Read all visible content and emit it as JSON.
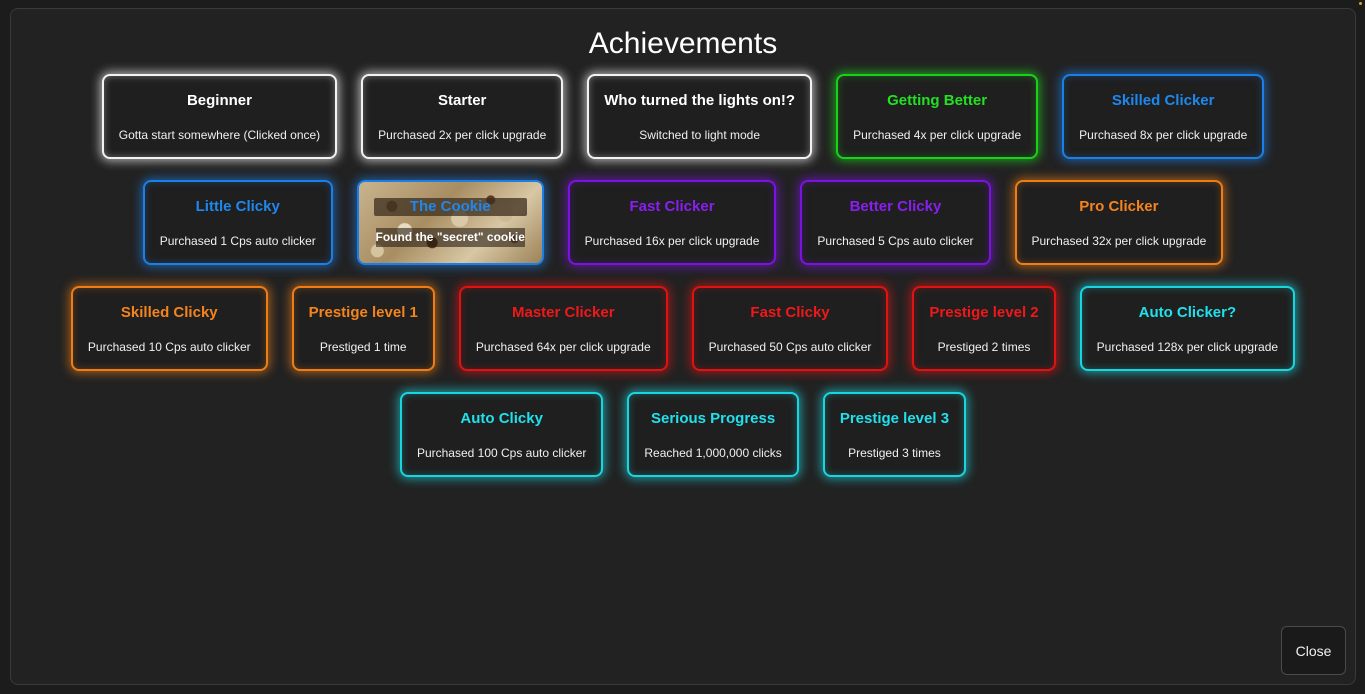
{
  "title": "Achievements",
  "close_label": "Close",
  "colors": {
    "white": "#ffffff",
    "green": "#22e022",
    "blue": "#1e88ee",
    "purple": "#8a1ef0",
    "orange": "#f5841c",
    "red": "#f01818",
    "cyan": "#20e0ec",
    "background": "#222222"
  },
  "rows": [
    [
      {
        "name": "Beginner",
        "desc": "Gotta start somewhere (Clicked once)",
        "color": "white"
      },
      {
        "name": "Starter",
        "desc": "Purchased 2x per click upgrade",
        "color": "white"
      },
      {
        "name": "Who turned the lights on!?",
        "desc": "Switched to light mode",
        "color": "white"
      },
      {
        "name": "Getting Better",
        "desc": "Purchased 4x per click upgrade",
        "color": "green"
      },
      {
        "name": "Skilled Clicker",
        "desc": "Purchased 8x per click upgrade",
        "color": "blue"
      }
    ],
    [
      {
        "name": "Little Clicky",
        "desc": "Purchased 1 Cps auto clicker",
        "color": "blue"
      },
      {
        "name": "The Cookie",
        "desc": "Found the \"secret\" cookie",
        "color": "cookie"
      },
      {
        "name": "Fast Clicker",
        "desc": "Purchased 16x per click upgrade",
        "color": "purple"
      },
      {
        "name": "Better Clicky",
        "desc": "Purchased 5 Cps auto clicker",
        "color": "purple"
      },
      {
        "name": "Pro Clicker",
        "desc": "Purchased 32x per click upgrade",
        "color": "orange"
      }
    ],
    [
      {
        "name": "Skilled Clicky",
        "desc": "Purchased 10 Cps auto clicker",
        "color": "orange"
      },
      {
        "name": "Prestige level 1",
        "desc": "Prestiged 1 time",
        "color": "orange"
      },
      {
        "name": "Master Clicker",
        "desc": "Purchased 64x per click upgrade",
        "color": "red"
      },
      {
        "name": "Fast Clicky",
        "desc": "Purchased 50 Cps auto clicker",
        "color": "red"
      },
      {
        "name": "Prestige level 2",
        "desc": "Prestiged 2 times",
        "color": "red"
      },
      {
        "name": "Auto Clicker?",
        "desc": "Purchased 128x per click upgrade",
        "color": "cyan"
      }
    ],
    [
      {
        "name": "Auto Clicky",
        "desc": "Purchased 100 Cps auto clicker",
        "color": "cyan"
      },
      {
        "name": "Serious Progress",
        "desc": "Reached 1,000,000 clicks",
        "color": "cyan"
      },
      {
        "name": "Prestige level 3",
        "desc": "Prestiged 3 times",
        "color": "cyan"
      }
    ]
  ]
}
